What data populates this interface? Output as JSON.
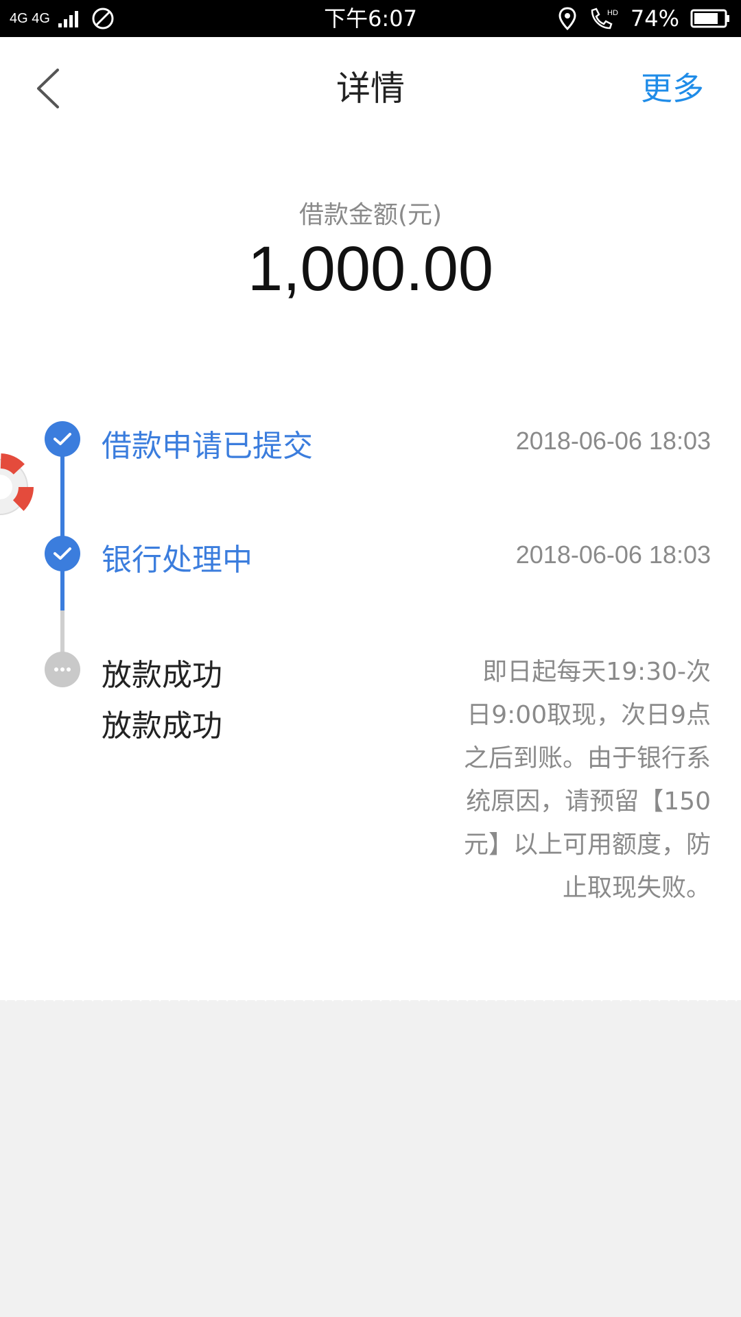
{
  "status_bar": {
    "network": "4G 4G",
    "time": "下午6:07",
    "battery": "74%"
  },
  "header": {
    "title": "详情",
    "more": "更多"
  },
  "amount": {
    "label": "借款金额(元)",
    "value": "1,000.00"
  },
  "timeline": [
    {
      "title": "借款申请已提交",
      "time": "2018-06-06 18:03",
      "state": "done"
    },
    {
      "title": "银行处理中",
      "time": "2018-06-06 18:03",
      "state": "done"
    },
    {
      "title": "放款成功",
      "subtitle": "放款成功",
      "description": "即日起每天19:30-次日9:00取现，次日9点之后到账。由于银行系统原因，请预留【150元】以上可用额度，防止取现失败。",
      "state": "pending"
    }
  ],
  "colors": {
    "accent_blue": "#3b7ddd",
    "link_blue": "#1f8ce8",
    "pending_gray": "#c9c9c9"
  }
}
